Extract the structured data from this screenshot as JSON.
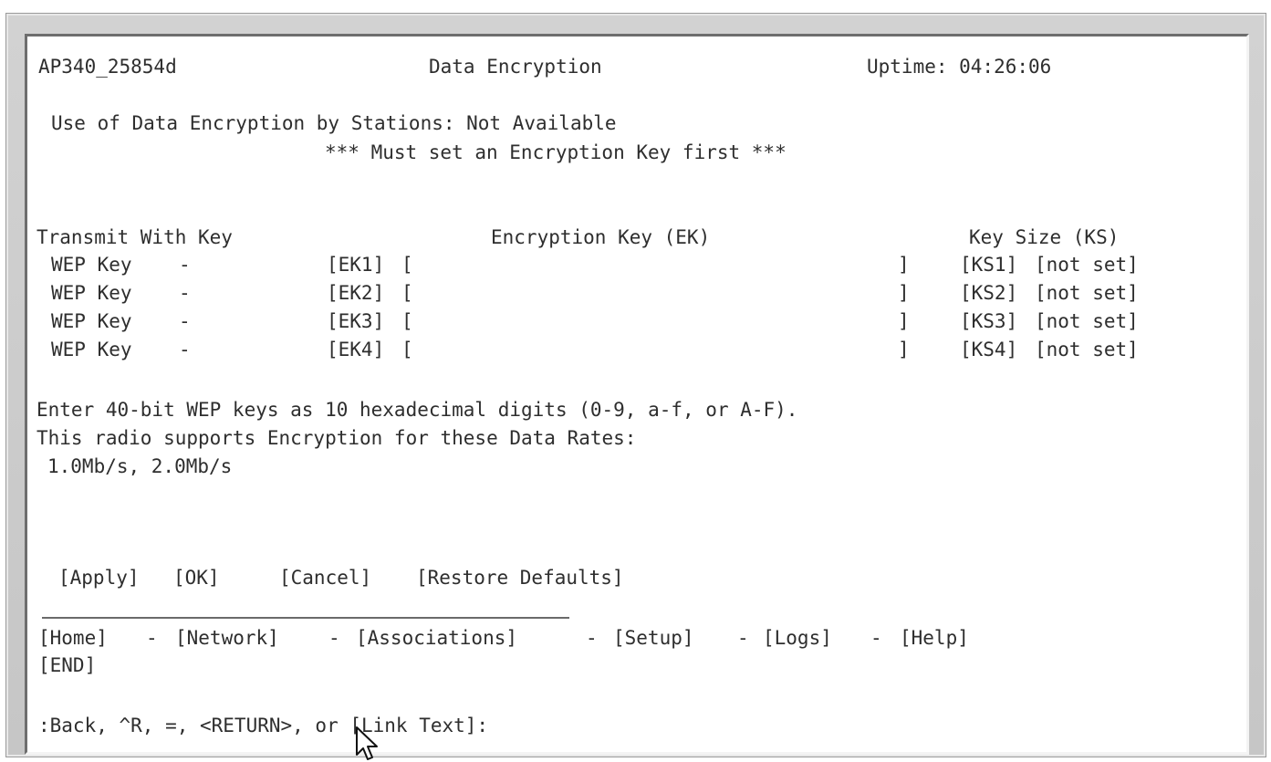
{
  "header": {
    "ap_name": "AP340_25854d",
    "title": "Data Encryption",
    "uptime": "Uptime: 04:26:06"
  },
  "status": {
    "use_line": "Use of Data Encryption by Stations: Not Available",
    "warning": "*** Must set an Encryption Key first ***"
  },
  "table": {
    "col_transmit": "Transmit With Key",
    "col_key": "Encryption Key (EK)",
    "col_size": "Key Size (KS)",
    "rows": [
      {
        "label": "WEP Key",
        "dash": "-",
        "ek": "[EK1]",
        "open": "[",
        "value": "",
        "close": "]",
        "ks": "[KS1]",
        "size": "[not set]"
      },
      {
        "label": "WEP Key",
        "dash": "-",
        "ek": "[EK2]",
        "open": "[",
        "value": "",
        "close": "]",
        "ks": "[KS2]",
        "size": "[not set]"
      },
      {
        "label": "WEP Key",
        "dash": "-",
        "ek": "[EK3]",
        "open": "[",
        "value": "",
        "close": "]",
        "ks": "[KS3]",
        "size": "[not set]"
      },
      {
        "label": "WEP Key",
        "dash": "-",
        "ek": "[EK4]",
        "open": "[",
        "value": "",
        "close": "]",
        "ks": "[KS4]",
        "size": "[not set]"
      }
    ]
  },
  "info": {
    "line1": "Enter 40-bit WEP keys as 10 hexadecimal digits (0-9, a-f, or A-F).",
    "line2": "This radio supports Encryption for these Data Rates:",
    "line3": "1.0Mb/s, 2.0Mb/s"
  },
  "actions": {
    "apply": "[Apply]",
    "ok": "[OK]",
    "cancel": "[Cancel]",
    "restore": "[Restore Defaults]"
  },
  "nav": {
    "home": "[Home]",
    "network": "[Network]",
    "associations": "[Associations]",
    "setup": "[Setup]",
    "logs": "[Logs]",
    "help": "[Help]",
    "sep": "-",
    "end": "[END]"
  },
  "prompt": ":Back, ^R, =, <RETURN>, or [Link Text]:"
}
